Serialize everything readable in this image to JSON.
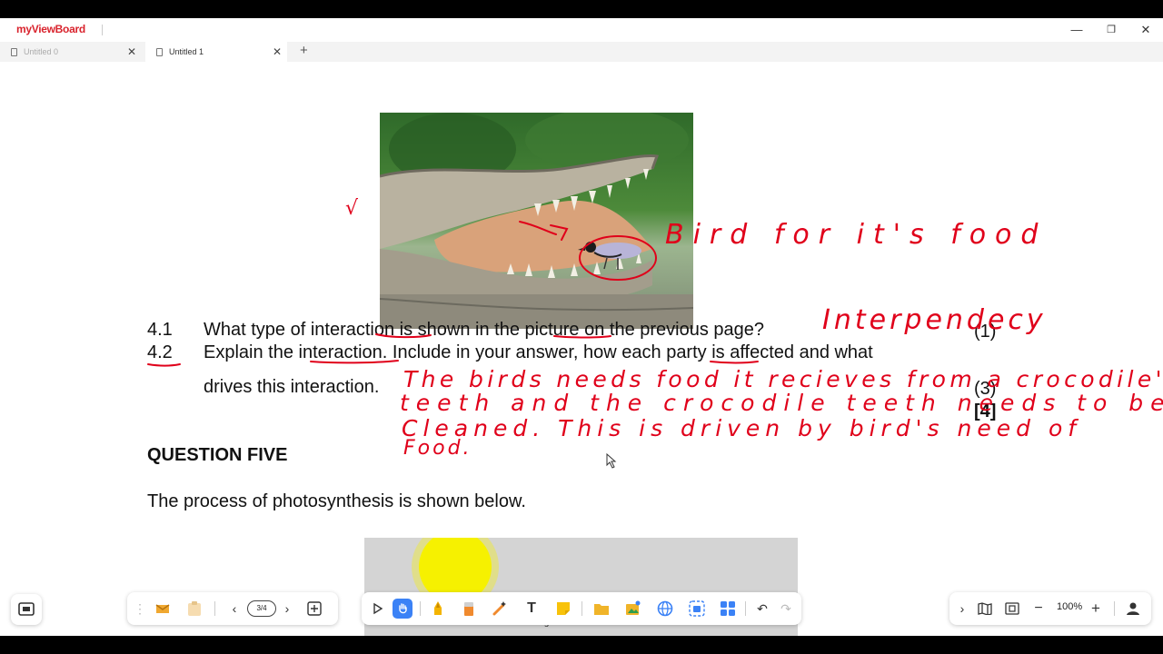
{
  "app": {
    "logo": "myViewBoard"
  },
  "window_controls": {
    "minimize": "—",
    "maximize": "❐",
    "close": "✕"
  },
  "tabs": [
    {
      "label": "Untitled 0",
      "active": false
    },
    {
      "label": "Untitled 1",
      "active": true
    }
  ],
  "tab_close": "✕",
  "tab_add": "+",
  "document": {
    "q41_num": "4.1",
    "q41_text": "What type of interaction is shown in the picture on the previous page?",
    "q41_mark": "(1)",
    "q42_num": "4.2",
    "q42_text_line1": "Explain the interaction. Include in your answer, how each party is affected and what",
    "q42_text_line2": "drives this interaction.",
    "q42_mark": "(3)",
    "total_mark": "[4]",
    "section_heading": "QUESTION FIVE",
    "q5_intro": "The process of photosynthesis is shown below.",
    "photo_label": "Light"
  },
  "handwriting": {
    "tick": "√",
    "bird_label": "Bird for it's food",
    "answer_41": "Interpendecy",
    "answer_line1": "The birds needs food it recieves from a crocodile's",
    "answer_line2": "teeth and the crocodile teeth needs to be",
    "answer_line3": "Cleaned. This is driven by bird's need of",
    "answer_line4": "Food."
  },
  "toolbar": {
    "page_indicator": "3/4",
    "zoom_level": "100%"
  },
  "colors": {
    "ink_red": "#e0001a",
    "accent_blue": "#3b82f6",
    "logo_red": "#d9232d"
  },
  "icons": {
    "capture": "capture-icon",
    "drag": "drag-handle-icon",
    "cloud": "cloud-icon",
    "clipboard": "clipboard-icon",
    "prev": "chevron-left-icon",
    "next": "chevron-right-icon",
    "add_page": "add-page-icon",
    "select": "select-arrow-icon",
    "hand": "hand-icon",
    "pen": "pen-icon",
    "eraser": "eraser-icon",
    "magic": "magic-icon",
    "text": "text-icon",
    "sticky": "sticky-note-icon",
    "folder": "folder-icon",
    "media": "media-icon",
    "globe": "globe-icon",
    "camera": "camera-icon",
    "apps": "apps-icon",
    "undo": "undo-icon",
    "redo": "redo-icon",
    "collapse": "chevron-right-icon",
    "map": "map-icon",
    "fit": "fit-screen-icon",
    "zoom_out": "minus-icon",
    "zoom_in": "plus-icon",
    "user": "user-icon"
  }
}
